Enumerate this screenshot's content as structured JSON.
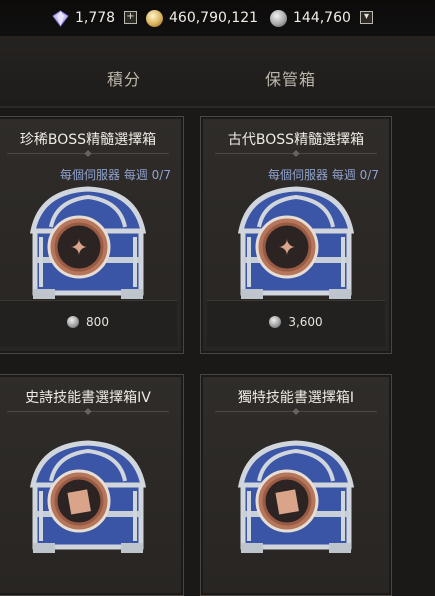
{
  "currency": {
    "gems": "1,778",
    "gold": "460,790,121",
    "silver": "144,760",
    "icons": [
      "gem-icon",
      "gold-coin-icon",
      "silver-coin-icon"
    ]
  },
  "tabs": [
    {
      "label": "積分"
    },
    {
      "label": "保管箱"
    }
  ],
  "cards": [
    {
      "title": "珍稀BOSS精髓選擇箱",
      "limit": "每個伺服器 每週 0/7",
      "price": "800"
    },
    {
      "title": "古代BOSS精髓選擇箱",
      "limit": "每個伺服器 每週 0/7",
      "price": "3,600"
    },
    {
      "title": "史詩技能書選擇箱IV",
      "limit": "",
      "price": ""
    },
    {
      "title": "獨特技能書選擇箱I",
      "limit": "",
      "price": ""
    }
  ],
  "colors": {
    "limit_text": "#8fa3d0",
    "chest_blue": "#3e58a8",
    "chest_silver": "#c7ccd3",
    "medallion": "#b3745b"
  }
}
